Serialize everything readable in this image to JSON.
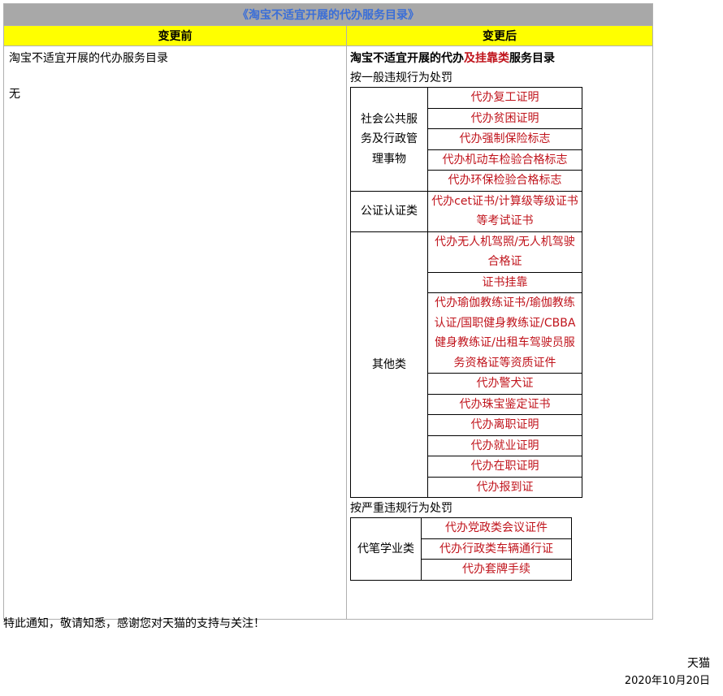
{
  "doc_title": "《淘宝不适宜开展的代办服务目录》",
  "headers": {
    "before": "变更前",
    "after": "变更后"
  },
  "before": {
    "line1": "淘宝不适宜开展的代办服务目录",
    "line2": "无"
  },
  "after": {
    "title_a": "淘宝不适宜开展的代办",
    "title_red": "及挂靠类",
    "title_b": "服务目录",
    "section1_label": "按一般违规行为处罚",
    "section1": {
      "cat1": "社会公共服务及行政管理事物",
      "cat1_items": [
        "代办复工证明",
        "代办贫困证明",
        "代办强制保险标志",
        "代办机动车检验合格标志",
        "代办环保检验合格标志"
      ],
      "cat2": "公证认证类",
      "cat2_items": [
        "代办cet证书/计算级等级证书等考试证书"
      ],
      "cat3": "其他类",
      "cat3_items": [
        "代办无人机驾照/无人机驾驶合格证",
        "证书挂靠",
        "代办瑜伽教练证书/瑜伽教练认证/国职健身教练证/CBBA健身教练证/出租车驾驶员服务资格证等资质证件",
        "代办警犬证",
        "代办珠宝鉴定证书",
        "代办离职证明",
        "代办就业证明",
        "代办在职证明",
        "代办报到证"
      ]
    },
    "section2_label": "按严重违规行为处罚",
    "section2": {
      "cat1": "代笔学业类",
      "cat1_items": [
        "代办党政类会议证件",
        "代办行政类车辆通行证",
        "代办套牌手续"
      ]
    }
  },
  "notice": "特此通知，敬请知悉，感谢您对天猫的支持与关注！",
  "signature": "天猫",
  "date": "2020年10月20日"
}
